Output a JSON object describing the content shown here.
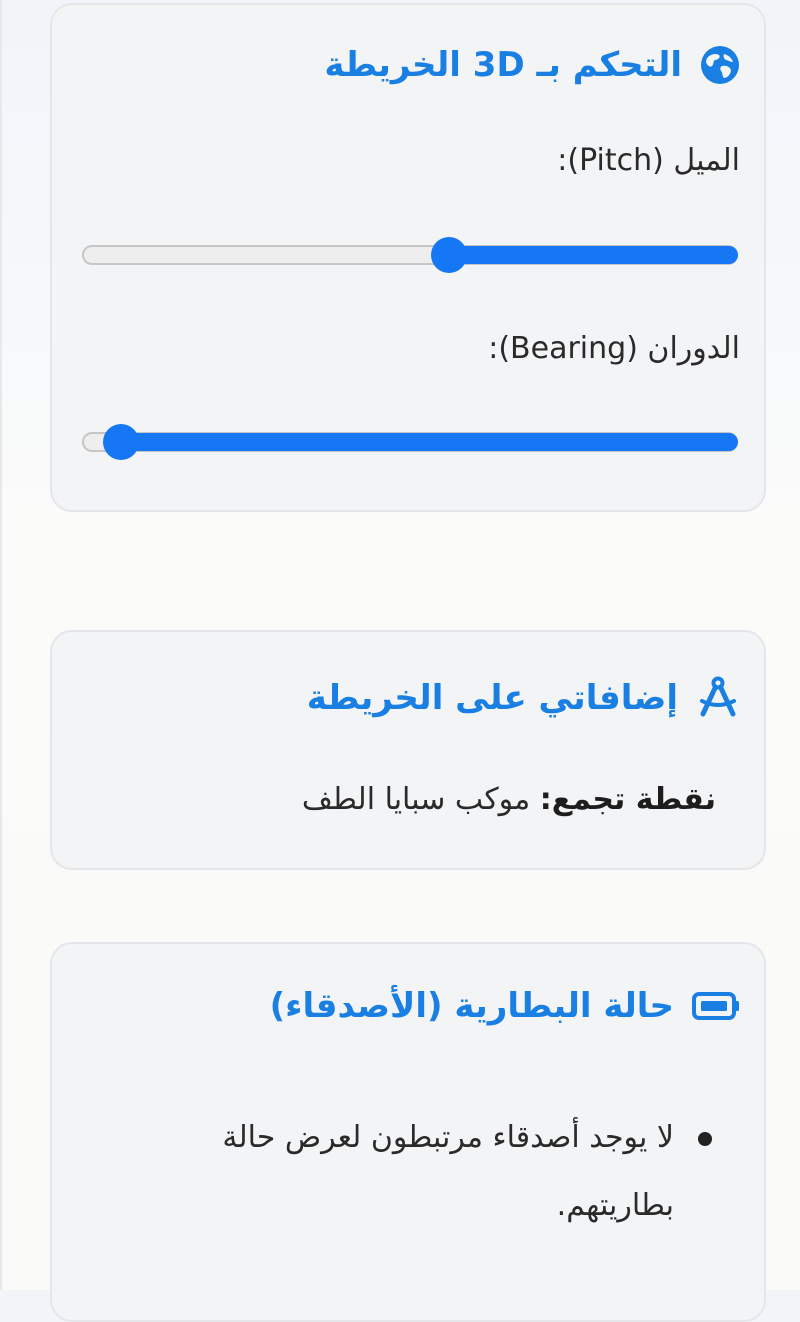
{
  "accent_color": "#1a7fe2",
  "slider_color": "#1677f4",
  "map3d": {
    "title": "التحكم بـ 3D الخريطة",
    "icon": "globe-icon",
    "pitch": {
      "label": "الميل (Pitch):",
      "value": 0.44
    },
    "bearing": {
      "label": "الدوران (Bearing):",
      "value": 0.94
    }
  },
  "addons": {
    "title": "إضافاتي على الخريطة",
    "icon": "drafting-compass-icon",
    "gather_label": "نقطة تجمع:",
    "gather_value": "موكب سبايا الطف"
  },
  "battery": {
    "title": "حالة البطارية (الأصدقاء)",
    "icon": "battery-icon",
    "items": [
      "لا يوجد أصدقاء مرتبطون لعرض حالة بطاريتهم."
    ]
  }
}
